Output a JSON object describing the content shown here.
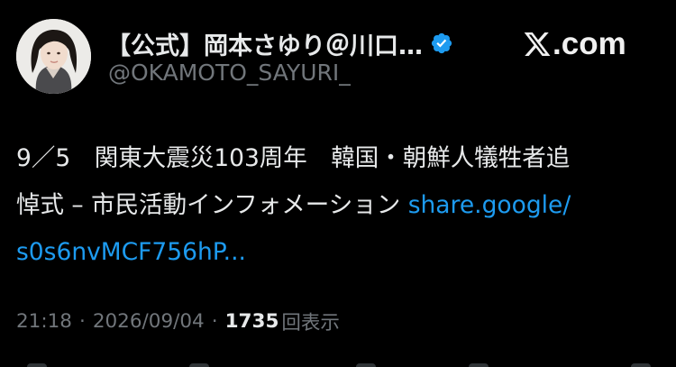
{
  "tweet": {
    "display_name": "【公式】岡本さゆり＠川口…",
    "verified_icon": "verified-badge-icon",
    "handle": "@OKAMOTO_SAYURI_",
    "text_line1": "9／5　関東大震災103周年　韓国・朝鮮人犠牲者追",
    "text_line2_plain": "悼式 – 市民活動インフォメーション ",
    "text_line2_link": "share.google/",
    "text_line3_link": "s0s6nvMCF756hP...",
    "time": "21:18",
    "date": "2026/09/04",
    "views_count": "1735",
    "views_label": "回表示"
  },
  "brand": {
    "icon": "x-logo-icon",
    "suffix": ".com"
  },
  "colors": {
    "background": "#000000",
    "primary_text": "#e7e9ea",
    "secondary_text": "#71767b",
    "link": "#1d9bf0",
    "verified": "#1d9bf0"
  }
}
